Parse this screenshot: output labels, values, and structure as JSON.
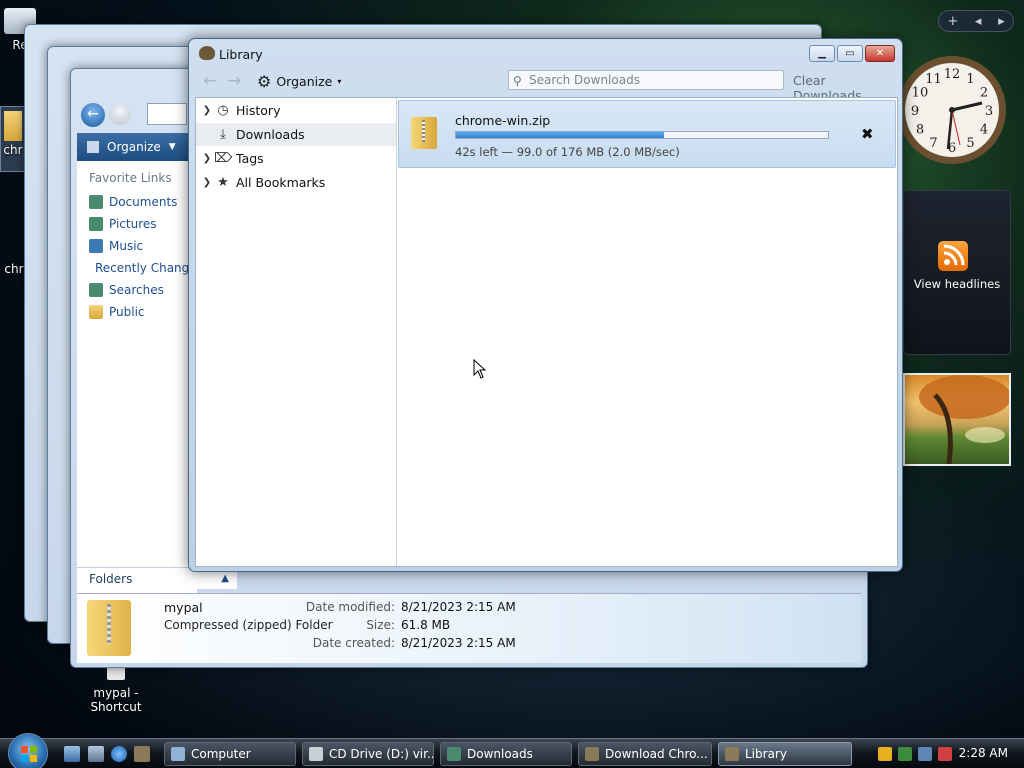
{
  "desktop": {
    "icons": [
      {
        "label": "Re"
      },
      {
        "label": "chr"
      },
      {
        "label": "chr"
      },
      {
        "label": "mypal - Shortcut"
      }
    ]
  },
  "sidebar": {
    "controls": [
      "+",
      "◂",
      "▸"
    ],
    "feed_label": "View headlines",
    "clock_numbers": [
      "12",
      "1",
      "2",
      "3",
      "4",
      "5",
      "6",
      "7",
      "8",
      "9",
      "10",
      "11"
    ]
  },
  "explorer": {
    "organize_label": "Organize",
    "favorite_links_title": "Favorite Links",
    "favorite_links": [
      "Documents",
      "Pictures",
      "Music",
      "Recently Changed",
      "Searches",
      "Public"
    ],
    "folders_label": "Folders",
    "details": {
      "name": "mypal",
      "type": "Compressed (zipped) Folder",
      "date_modified_label": "Date modified:",
      "date_modified": "8/21/2023 2:15 AM",
      "size_label": "Size:",
      "size": "61.8 MB",
      "date_created_label": "Date created:",
      "date_created": "8/21/2023 2:15 AM"
    }
  },
  "library": {
    "title": "Library",
    "organize_label": "Organize",
    "search_placeholder": "Search Downloads",
    "clear_downloads_label": "Clear Downloads",
    "tree": [
      {
        "label": "History",
        "icon": "clock-icon",
        "twisty": true,
        "selected": false
      },
      {
        "label": "Downloads",
        "icon": "download-icon",
        "twisty": false,
        "selected": true
      },
      {
        "label": "Tags",
        "icon": "tag-icon",
        "twisty": true,
        "selected": false
      },
      {
        "label": "All Bookmarks",
        "icon": "star-icon",
        "twisty": true,
        "selected": false
      }
    ],
    "download": {
      "filename": "chrome-win.zip",
      "progress_percent": 56,
      "status": "42s left — 99.0 of 176 MB (2.0 MB/sec)"
    }
  },
  "taskbar": {
    "buttons": [
      {
        "label": "Computer",
        "active": false
      },
      {
        "label": "CD Drive (D:) vir...",
        "active": false
      },
      {
        "label": "Downloads",
        "active": false
      },
      {
        "label": "Download Chro...",
        "active": false
      },
      {
        "label": "Library",
        "active": true
      }
    ],
    "clock": "2:28 AM"
  },
  "colors": {
    "accent": "#2f7fd0",
    "progress_fill": "#4a9be6",
    "close_button": "#c4382a"
  }
}
